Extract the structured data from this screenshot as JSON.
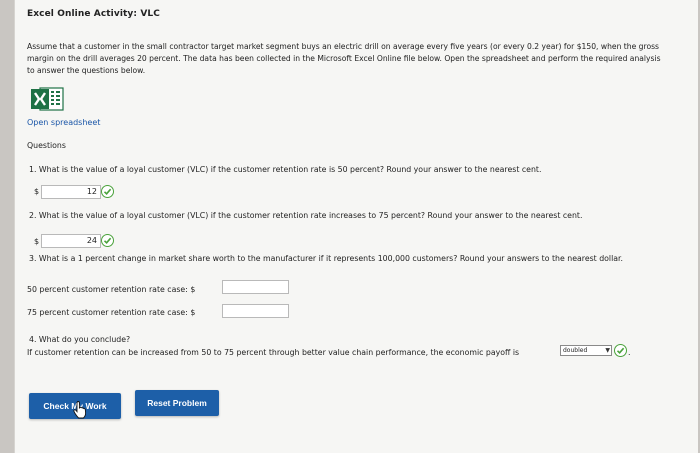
{
  "title": "Excel Online Activity: VLC",
  "intro": "Assume that a customer in the small contractor target market segment buys an electric drill on average every five years (or every 0.2 year) for $150, when the gross margin on the drill averages 20 percent. The data has been collected in the Microsoft Excel Online file below. Open the spreadsheet and perform the required analysis to answer the questions below.",
  "open_link": "Open spreadsheet",
  "questions_heading": "Questions",
  "q1": {
    "text": "1. What is the value of a loyal customer (VLC) if the customer retention rate is 50 percent? Round your answer to the nearest cent.",
    "currency": "$",
    "answer": "12"
  },
  "q2": {
    "text": "2. What is the value of a loyal customer (VLC) if the customer retention rate increases to 75 percent? Round your answer to the nearest cent.",
    "currency": "$",
    "answer": "24"
  },
  "q3": {
    "text": "3. What is a 1 percent change in market share worth to the manufacturer if it represents 100,000 customers? Round your answers to the nearest dollar.",
    "case50_label": "50 percent customer retention rate case: $",
    "case50_value": "",
    "case75_label": "75 percent customer retention rate case: $",
    "case75_value": ""
  },
  "q4": {
    "text": "4. What do you conclude?",
    "statement": "If customer retention can be increased from 50 to 75 percent through better value chain performance, the economic payoff is",
    "selected": "doubled",
    "period": "."
  },
  "buttons": {
    "check": "Check My Work",
    "reset": "Reset Problem"
  },
  "colors": {
    "button_blue": "#1d5fa8",
    "check_green": "#4aa23b",
    "link_blue": "#1a56a8",
    "excel_green": "#1e7145"
  }
}
